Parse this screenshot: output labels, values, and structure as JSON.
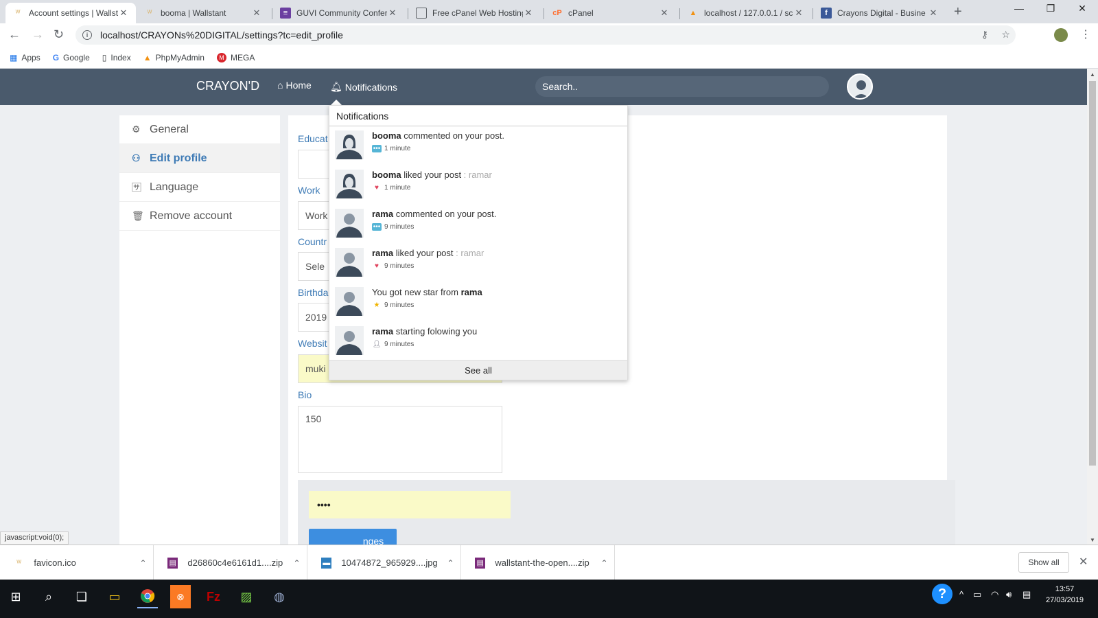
{
  "browser": {
    "tabs": [
      {
        "title": "Account settings | Wallst",
        "active": true,
        "favicon_color": "#d9b36a"
      },
      {
        "title": "booma | Wallstant",
        "active": false,
        "favicon_color": "#d9b36a"
      },
      {
        "title": "GUVI Community Confer",
        "active": false,
        "favicon_color": "#6b3fa0"
      },
      {
        "title": "Free cPanel Web Hosting",
        "active": false,
        "favicon_color": "#5f6368"
      },
      {
        "title": "cPanel",
        "active": false,
        "favicon_color": "#ff6c2c"
      },
      {
        "title": "localhost / 127.0.0.1 / sc",
        "active": false,
        "favicon_color": "#f29111"
      },
      {
        "title": "Crayons Digital - Busine",
        "active": false,
        "favicon_color": "#3b5998"
      }
    ],
    "url": "localhost/CRAYONs%20DIGITAL/settings?tc=edit_profile",
    "bookmarks": [
      {
        "label": "Apps",
        "icon": "apps-grid-icon"
      },
      {
        "label": "Google",
        "icon": "google-icon"
      },
      {
        "label": "Index",
        "icon": "page-icon"
      },
      {
        "label": "PhpMyAdmin",
        "icon": "phpmyadmin-icon"
      },
      {
        "label": "MEGA",
        "icon": "mega-icon"
      }
    ]
  },
  "site": {
    "brand": "CRAYON'D",
    "nav": {
      "home": "Home",
      "notifications": "Notifications"
    },
    "search_placeholder": "Search.."
  },
  "sidebar": {
    "items": [
      {
        "label": "General",
        "icon": "gears-icon",
        "active": false
      },
      {
        "label": "Edit profile",
        "icon": "user-icon",
        "active": true
      },
      {
        "label": "Language",
        "icon": "language-icon",
        "active": false
      },
      {
        "label": "Remove account",
        "icon": "trash-icon",
        "active": false
      }
    ]
  },
  "form": {
    "education_label": "Educat",
    "education_value": "",
    "work_label": "Work",
    "work_value": "Work",
    "country_label": "Countr",
    "country_value": "Sele",
    "birthday_label": "Birthda",
    "birthday_value": "2019",
    "website_label": "Websit",
    "website_value": "muki",
    "bio_label": "Bio",
    "bio_value": "150",
    "password_value": "••••",
    "save_label": "nges"
  },
  "notifications": {
    "title": "Notifications",
    "items": [
      {
        "user": "booma",
        "text": " commented on your post.",
        "suffix": "",
        "time": "1 minute",
        "type": "comment"
      },
      {
        "user": "booma",
        "text": " liked your post",
        "suffix": " : ramar",
        "time": "1 minute",
        "type": "like"
      },
      {
        "user": "rama",
        "text": " commented on your post.",
        "suffix": "",
        "time": "9 minutes",
        "type": "comment"
      },
      {
        "user": "rama",
        "text": " liked your post",
        "suffix": " : ramar",
        "time": "9 minutes",
        "type": "like"
      },
      {
        "prefix": "You got new star from ",
        "user": "rama",
        "time": "9 minutes",
        "type": "star"
      },
      {
        "user": "rama",
        "text": " starting folowing you",
        "suffix": "",
        "time": "9 minutes",
        "type": "follow"
      }
    ],
    "see_all": "See all"
  },
  "status_bar": "javascript:void(0);",
  "downloads": {
    "items": [
      {
        "name": "favicon.ico",
        "icon": "favicon-file-icon"
      },
      {
        "name": "d26860c4e6161d1....zip",
        "icon": "zip-file-icon"
      },
      {
        "name": "10474872_965929....jpg",
        "icon": "image-file-icon"
      },
      {
        "name": "wallstant-the-open....zip",
        "icon": "zip-file-icon"
      }
    ],
    "show_all": "Show all"
  },
  "taskbar": {
    "time": "13:57",
    "date": "27/03/2019"
  }
}
